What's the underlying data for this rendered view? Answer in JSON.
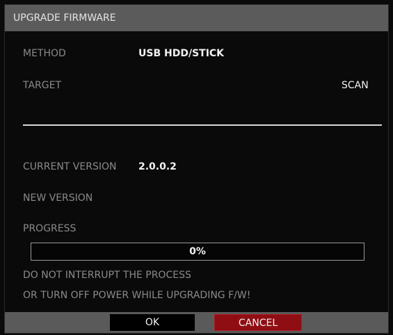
{
  "dialog": {
    "title": "UPGRADE FIRMWARE",
    "method_label": "METHOD",
    "method_value": "USB HDD/STICK",
    "target_label": "TARGET",
    "scan_label": "SCAN",
    "current_version_label": "CURRENT VERSION",
    "current_version_value": "2.0.0.2",
    "new_version_label": "NEW VERSION",
    "progress_label": "PROGRESS",
    "progress_value": 0,
    "progress_text": "0%",
    "warning_line1": "DO NOT INTERRUPT THE PROCESS",
    "warning_line2": "OR TURN OFF POWER WHILE UPGRADING F/W!"
  },
  "buttons": {
    "ok_label": "OK",
    "cancel_label": "CANCEL"
  },
  "colors": {
    "title_bar": "#5b5b5b",
    "cancel_button": "#8f0e14",
    "ok_button": "#000000",
    "label_text": "#8a8a8a",
    "value_text": "#f2f2f2"
  }
}
